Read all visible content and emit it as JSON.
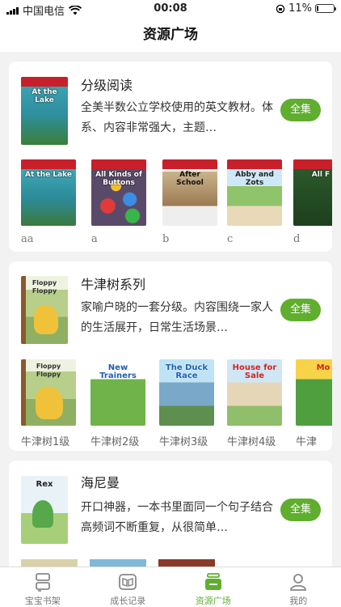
{
  "status": {
    "carrier": "中国电信",
    "time": "00:08",
    "battery": "11%",
    "battery_level": 0.11
  },
  "nav": {
    "title": "资源广场"
  },
  "sections": [
    {
      "title": "分级阅读",
      "desc": "全美半数公立学校使用的英文教材。体系、内容非常强大，主题…",
      "button": "全集",
      "cover_title": "At the Lake",
      "books": [
        {
          "label": "aa",
          "title": "At the Lake"
        },
        {
          "label": "a",
          "title": "All Kinds of Buttons"
        },
        {
          "label": "b",
          "title": "After School"
        },
        {
          "label": "c",
          "title": "Abby and Zots"
        },
        {
          "label": "d",
          "title": "All F"
        }
      ]
    },
    {
      "title": "牛津树系列",
      "desc": "家喻户晓的一套分级。内容围绕一家人的生活展开，日常生活场景…",
      "button": "全集",
      "cover_title": "Floppy Floppy",
      "books": [
        {
          "label": "牛津树1级",
          "title": "Floppy Floppy"
        },
        {
          "label": "牛津树2级",
          "title": "New Trainers"
        },
        {
          "label": "牛津树3级",
          "title": "The Duck Race"
        },
        {
          "label": "牛津树4级",
          "title": "House for Sale"
        },
        {
          "label": "牛津",
          "title": "Mo"
        }
      ]
    },
    {
      "title": "海尼曼",
      "desc": "开口神器，一本书里面同一个句子结合高频词不断重复，从很简单…",
      "button": "全集",
      "cover_title": "Rex",
      "books": []
    }
  ],
  "tabs": [
    {
      "label": "宝宝书架",
      "icon": "bookshelf-icon"
    },
    {
      "label": "成长记录",
      "icon": "book-open-icon"
    },
    {
      "label": "资源广场",
      "icon": "resource-box-icon",
      "active": true
    },
    {
      "label": "我的",
      "icon": "person-icon"
    }
  ],
  "colors": {
    "accent": "#5fae2d",
    "background": "#f2f2f2"
  }
}
